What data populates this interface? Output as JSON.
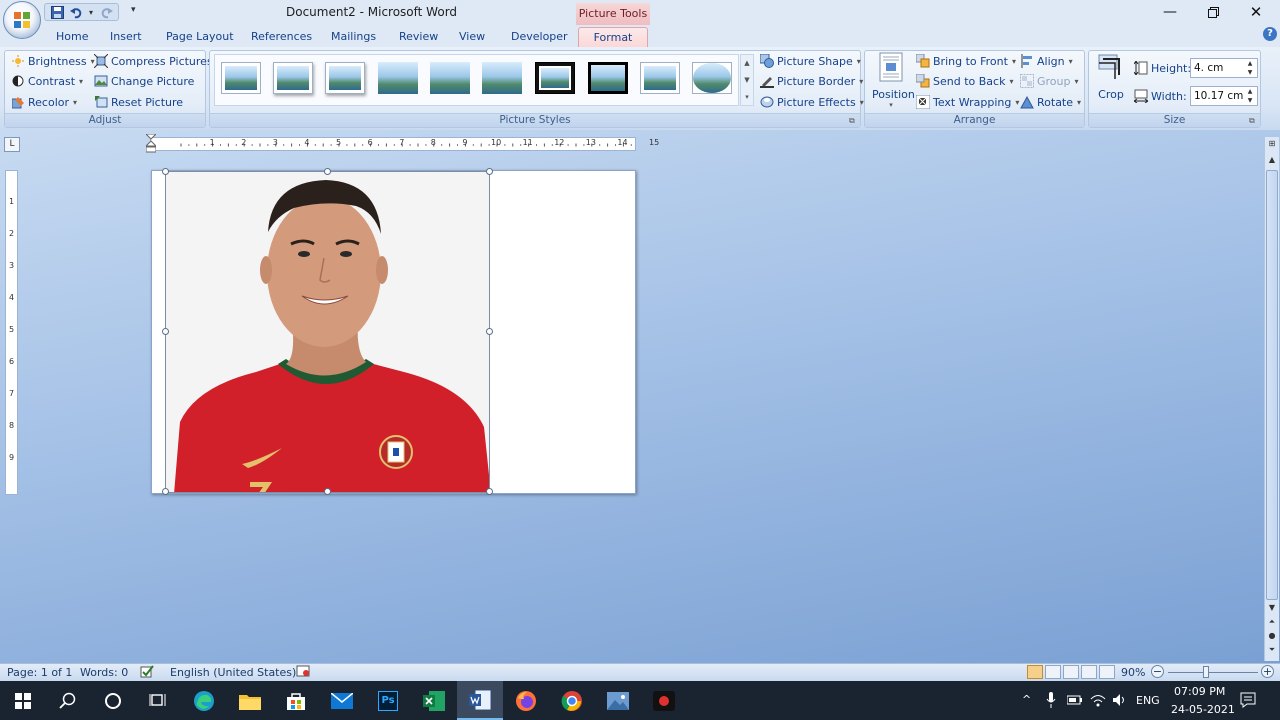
{
  "window": {
    "title": "Document2 - Microsoft Word",
    "context_tab": "Picture Tools"
  },
  "tabs": [
    "Home",
    "Insert",
    "Page Layout",
    "References",
    "Mailings",
    "Review",
    "View",
    "Developer",
    "Format"
  ],
  "active_tab": "Format",
  "ribbon": {
    "adjust": {
      "label": "Adjust",
      "brightness": "Brightness",
      "contrast": "Contrast",
      "recolor": "Recolor",
      "compress": "Compress Pictures",
      "change": "Change Picture",
      "reset": "Reset Picture"
    },
    "picture_styles": {
      "label": "Picture Styles",
      "shape": "Picture Shape",
      "border": "Picture Border",
      "effects": "Picture Effects",
      "style_count": 10
    },
    "arrange": {
      "label": "Arrange",
      "position": "Position",
      "bring_front": "Bring to Front",
      "send_back": "Send to Back",
      "text_wrapping": "Text Wrapping",
      "align": "Align",
      "group": "Group",
      "rotate": "Rotate"
    },
    "size": {
      "label": "Size",
      "crop": "Crop",
      "height_label": "Height:",
      "height_value": "4. cm",
      "width_label": "Width:",
      "width_value": "10.17 cm"
    }
  },
  "ruler": {
    "h_numbers": [
      "1",
      "2",
      "3",
      "4",
      "5",
      "6",
      "7",
      "8",
      "9",
      "10",
      "11",
      "12",
      "13",
      "14",
      "15"
    ],
    "v_numbers": [
      "1",
      "2",
      "3",
      "4",
      "5",
      "6",
      "7",
      "8",
      "9"
    ]
  },
  "status": {
    "page": "Page: 1 of 1",
    "words": "Words: 0",
    "language": "English (United States)",
    "zoom": "90%"
  },
  "taskbar": {
    "apps": [
      "start-icon",
      "search-icon",
      "cortana-icon",
      "task-view-icon",
      "edge-icon",
      "file-explorer-icon",
      "store-icon",
      "mail-icon",
      "photoshop-icon",
      "excel-icon",
      "word-icon",
      "firefox-icon",
      "chrome-icon",
      "recorder-icon"
    ],
    "ps_label": "Ps",
    "lang": "ENG",
    "time": "07:09 PM",
    "date": "24-05-2021"
  },
  "colors": {
    "accent": "#15428b",
    "context_tab": "#efbdc0",
    "jersey": "#d1202a",
    "taskbar": "#1a2330"
  }
}
